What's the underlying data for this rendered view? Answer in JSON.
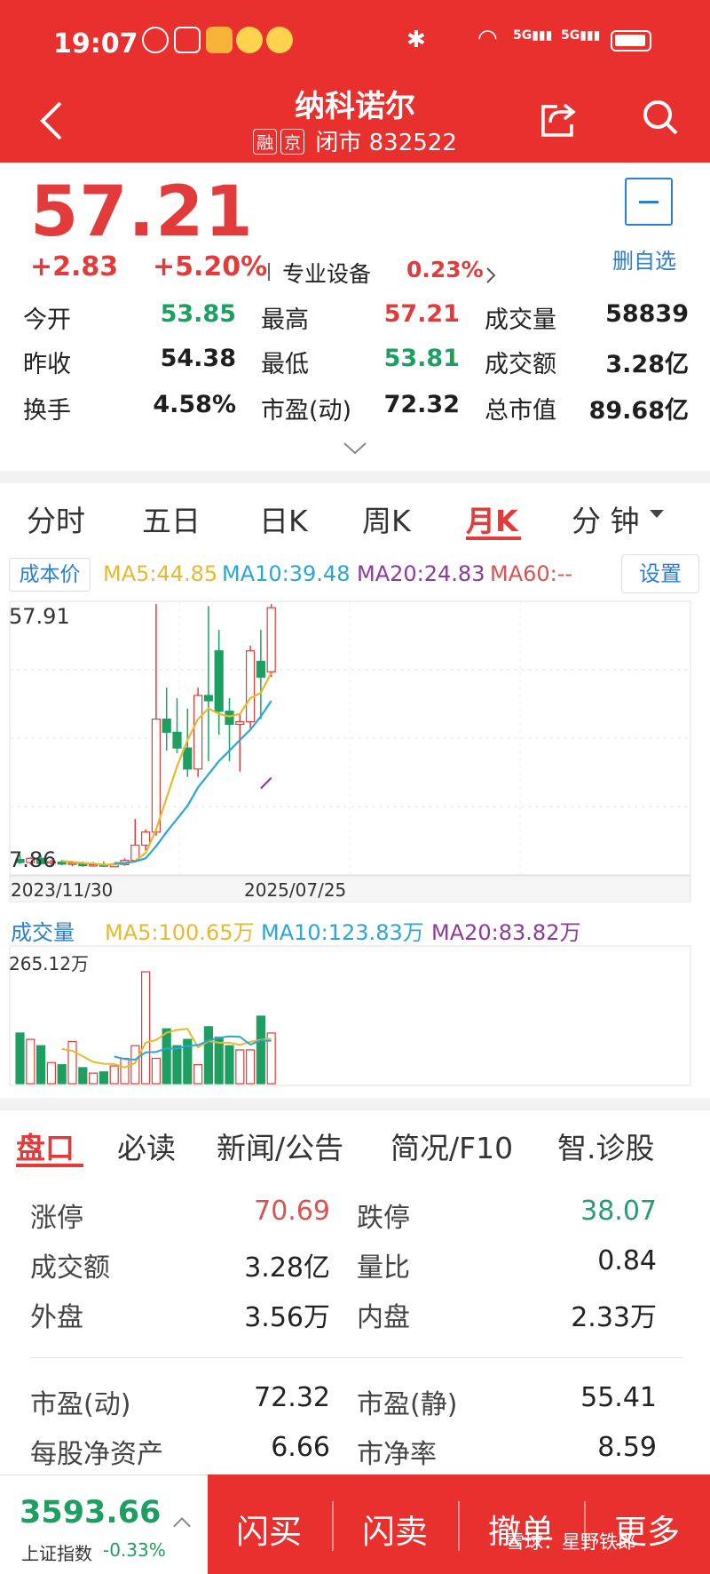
{
  "status": {
    "time": "19:07"
  },
  "header": {
    "title": "纳科诺尔",
    "tags": [
      "融",
      "京"
    ],
    "status_code": "闭市 832522"
  },
  "quote": {
    "price": "57.21",
    "change": "+2.83",
    "change_pct": "+5.20%",
    "sector_label": "专业设备",
    "sector_pct": "0.23%",
    "fav_label": "删自选",
    "rows": [
      [
        {
          "k": "今开",
          "v": "53.85",
          "c": "green"
        },
        {
          "k": "最高",
          "v": "57.21",
          "c": "red"
        },
        {
          "k": "成交量",
          "v": "58839",
          "c": "dark"
        }
      ],
      [
        {
          "k": "昨收",
          "v": "54.38",
          "c": "dark"
        },
        {
          "k": "最低",
          "v": "53.81",
          "c": "green"
        },
        {
          "k": "成交额",
          "v": "3.28亿",
          "c": "dark"
        }
      ],
      [
        {
          "k": "换手",
          "v": "4.58%",
          "c": "dark"
        },
        {
          "k": "市盈(动)",
          "v": "72.32",
          "c": "dark"
        },
        {
          "k": "总市值",
          "v": "89.68亿",
          "c": "dark"
        }
      ]
    ]
  },
  "period_tabs": [
    "分时",
    "五日",
    "日K",
    "周K",
    "月K",
    "分 钟"
  ],
  "active_period": "月K",
  "ma_bar": {
    "cost_label": "成本价",
    "ma5": "MA5:44.85",
    "ma10": "MA10:39.48",
    "ma20": "MA20:24.83",
    "ma60": "MA60:--",
    "settings": "设置"
  },
  "chart_data": {
    "type": "candlestick",
    "title": "",
    "period": "月K",
    "y_max_label": "57.91",
    "y_min_label": "7.86",
    "ylim": [
      7.86,
      57.91
    ],
    "x_labels": [
      "2023/11/30",
      "2025/07/25"
    ],
    "candles": [
      {
        "o": 9.3,
        "h": 10.2,
        "l": 8.4,
        "c": 8.7
      },
      {
        "o": 8.7,
        "h": 9.7,
        "l": 8.3,
        "c": 9.5
      },
      {
        "o": 9.5,
        "h": 10.1,
        "l": 8.3,
        "c": 8.5
      },
      {
        "o": 8.6,
        "h": 9.2,
        "l": 8.0,
        "c": 8.9
      },
      {
        "o": 8.8,
        "h": 9.2,
        "l": 8.2,
        "c": 8.4
      },
      {
        "o": 8.4,
        "h": 9.0,
        "l": 8.0,
        "c": 8.6
      },
      {
        "o": 8.6,
        "h": 8.9,
        "l": 7.9,
        "c": 8.1
      },
      {
        "o": 8.1,
        "h": 8.8,
        "l": 7.9,
        "c": 8.3
      },
      {
        "o": 8.3,
        "h": 8.9,
        "l": 7.86,
        "c": 8.0
      },
      {
        "o": 7.9,
        "h": 8.6,
        "l": 7.86,
        "c": 8.4
      },
      {
        "o": 8.3,
        "h": 9.5,
        "l": 8.1,
        "c": 9.1
      },
      {
        "o": 9.1,
        "h": 17.0,
        "l": 8.8,
        "c": 12.0
      },
      {
        "o": 12.0,
        "h": 15.0,
        "l": 11.0,
        "c": 14.5
      },
      {
        "o": 14.5,
        "h": 57.91,
        "l": 13.8,
        "c": 36.0
      },
      {
        "o": 36.0,
        "h": 42.0,
        "l": 30.0,
        "c": 33.5
      },
      {
        "o": 33.5,
        "h": 40.0,
        "l": 29.5,
        "c": 30.5
      },
      {
        "o": 30.5,
        "h": 38.0,
        "l": 25.0,
        "c": 26.5
      },
      {
        "o": 26.5,
        "h": 42.0,
        "l": 25.0,
        "c": 40.5
      },
      {
        "o": 40.5,
        "h": 57.5,
        "l": 28.0,
        "c": 39.5
      },
      {
        "o": 49.0,
        "h": 53.0,
        "l": 33.0,
        "c": 37.5
      },
      {
        "o": 37.5,
        "h": 40.0,
        "l": 28.0,
        "c": 35.0
      },
      {
        "o": 35.0,
        "h": 37.0,
        "l": 26.0,
        "c": 35.5
      },
      {
        "o": 35.5,
        "h": 50.0,
        "l": 34.0,
        "c": 49.0
      },
      {
        "o": 47.0,
        "h": 53.0,
        "l": 36.0,
        "c": 44.0
      },
      {
        "o": 45.0,
        "h": 57.91,
        "l": 44.0,
        "c": 57.21
      }
    ],
    "ma_lines": [
      {
        "name": "MA5",
        "color": "#e8b92f",
        "values": [
          null,
          null,
          null,
          null,
          9.0,
          8.8,
          8.6,
          8.5,
          8.3,
          8.3,
          8.5,
          9.0,
          10.5,
          15.0,
          21.0,
          27.0,
          32.0,
          36.0,
          38.0,
          37.0,
          36.5,
          37.0,
          40.0,
          41.0,
          44.85
        ]
      },
      {
        "name": "MA10",
        "color": "#2aa6d6",
        "values": [
          null,
          null,
          null,
          null,
          null,
          null,
          null,
          null,
          null,
          8.6,
          8.6,
          8.9,
          9.5,
          11.8,
          14.5,
          17.0,
          19.5,
          23.0,
          25.5,
          28.0,
          30.0,
          32.0,
          34.0,
          36.5,
          39.48
        ]
      },
      {
        "name": "MA20",
        "color": "#8e3a9c",
        "values": [
          null,
          null,
          null,
          null,
          null,
          null,
          null,
          null,
          null,
          null,
          null,
          null,
          null,
          null,
          null,
          null,
          null,
          null,
          null,
          null,
          null,
          null,
          null,
          22.8,
          24.83
        ]
      }
    ],
    "volume": {
      "label": "成交量",
      "max_label": "265.12万",
      "ma5": "MA5:100.65万",
      "ma10": "MA10:123.83万",
      "ma20": "MA20:83.82万",
      "values": [
        120,
        105,
        90,
        50,
        45,
        100,
        38,
        25,
        28,
        42,
        60,
        90,
        265.12,
        60,
        130,
        90,
        105,
        45,
        135,
        110,
        90,
        80,
        80,
        160,
        120
      ]
    }
  },
  "info_tabs": [
    "盘口",
    "必读",
    "新闻/公告",
    "简况/F10",
    "智.诊股"
  ],
  "pankou": {
    "rows": [
      [
        {
          "k": "涨停",
          "v": "70.69",
          "c": "#d9534f"
        },
        {
          "k": "跌停",
          "v": "38.07",
          "c": "#2a9a72"
        }
      ],
      [
        {
          "k": "成交额",
          "v": "3.28亿",
          "c": "#222222"
        },
        {
          "k": "量比",
          "v": "0.84",
          "c": "#222222"
        }
      ],
      [
        {
          "k": "外盘",
          "v": "3.56万",
          "c": "#222222"
        },
        {
          "k": "内盘",
          "v": "2.33万",
          "c": "#222222"
        }
      ],
      [
        {
          "k": "市盈(动)",
          "v": "72.32",
          "c": "#222222"
        },
        {
          "k": "市盈(静)",
          "v": "55.41",
          "c": "#222222"
        }
      ],
      [
        {
          "k": "每股净资产",
          "v": "6.66",
          "c": "#222222"
        },
        {
          "k": "市净率",
          "v": "8.59",
          "c": "#222222"
        }
      ]
    ]
  },
  "bottom": {
    "index_value": "3593.66",
    "index_name": "上证指数",
    "index_change": "-0.33%",
    "actions": [
      "闪买",
      "闪卖",
      "撤单",
      "更多"
    ],
    "watermark": "雪球：星野铁郎"
  }
}
